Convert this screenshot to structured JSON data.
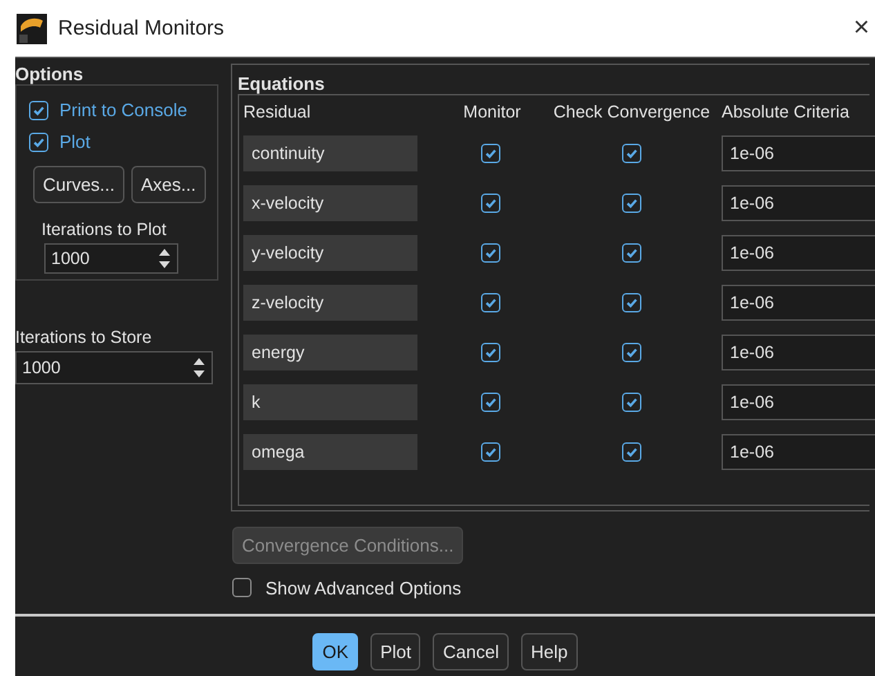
{
  "window": {
    "title": "Residual Monitors",
    "close": "×"
  },
  "options": {
    "title": "Options",
    "checkboxes": [
      {
        "label": "Print to Console",
        "checked": true
      },
      {
        "label": "Plot",
        "checked": true
      }
    ],
    "buttons": [
      "Curves...",
      "Axes..."
    ],
    "iterations_to_plot": {
      "label": "Iterations to Plot",
      "value": "1000"
    }
  },
  "iterations_to_store": {
    "label": "Iterations to Store",
    "value": "1000"
  },
  "equations": {
    "title": "Equations",
    "columns": [
      "Residual",
      "Monitor",
      "Check Convergence",
      "Absolute Criteria"
    ],
    "rows": [
      {
        "residual": "continuity",
        "monitor": true,
        "check_convergence": true,
        "absolute_criteria": "1e-06"
      },
      {
        "residual": "x-velocity",
        "monitor": true,
        "check_convergence": true,
        "absolute_criteria": "1e-06"
      },
      {
        "residual": "y-velocity",
        "monitor": true,
        "check_convergence": true,
        "absolute_criteria": "1e-06"
      },
      {
        "residual": "z-velocity",
        "monitor": true,
        "check_convergence": true,
        "absolute_criteria": "1e-06"
      },
      {
        "residual": "energy",
        "monitor": true,
        "check_convergence": true,
        "absolute_criteria": "1e-06"
      },
      {
        "residual": "k",
        "monitor": true,
        "check_convergence": true,
        "absolute_criteria": "1e-06"
      },
      {
        "residual": "omega",
        "monitor": true,
        "check_convergence": true,
        "absolute_criteria": "1e-06"
      }
    ]
  },
  "convergence_conditions": {
    "label": "Convergence Conditions...",
    "disabled": true
  },
  "show_advanced_options": {
    "label": "Show Advanced Options",
    "checked": false
  },
  "buttons": [
    {
      "label": "OK",
      "default": true
    },
    {
      "label": "Plot",
      "default": false
    },
    {
      "label": "Cancel",
      "default": false
    },
    {
      "label": "Help",
      "default": false
    }
  ]
}
